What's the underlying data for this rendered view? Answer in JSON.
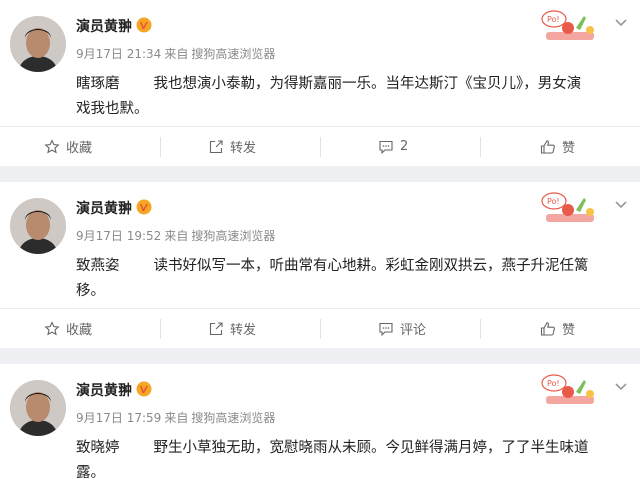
{
  "posts": [
    {
      "author": "演员黄翀",
      "time": "9月17日 21:34",
      "source_prefix": "来自",
      "source": "搜狗高速浏览器",
      "to": "瞎琢磨",
      "text_line1": "我也想演小泰勒，为得斯嘉丽一乐。当年达斯汀《宝贝儿》，男女演",
      "text_line2": "戏我也默。",
      "actions": {
        "favorite": "收藏",
        "repost": "转发",
        "comment": "2",
        "like": "赞"
      }
    },
    {
      "author": "演员黄翀",
      "time": "9月17日 19:52",
      "source_prefix": "来自",
      "source": "搜狗高速浏览器",
      "to": "致燕姿",
      "text_line1": "读书好似写一本，听曲常有心地耕。彩虹金刚双拱云，燕子升泥任篱",
      "text_line2": "移。",
      "actions": {
        "favorite": "收藏",
        "repost": "转发",
        "comment": "评论",
        "like": "赞"
      }
    },
    {
      "author": "演员黄翀",
      "time": "9月17日 17:59",
      "source_prefix": "来自",
      "source": "搜狗高速浏览器",
      "to": "致晓婷",
      "text_line1": "野生小草独无助，宽慰晓雨从未顾。今见鲜得满月婷，了了半生味道",
      "text_line2": "露。"
    }
  ],
  "icons": [
    "vip-badge-icon",
    "star-icon",
    "repost-icon",
    "comment-icon",
    "thumbs-up-icon",
    "chevron-down-icon"
  ],
  "colors": {
    "accent_vip": "#f5a623",
    "vip_red": "#e8533e",
    "meta_gray": "#8a8a8a",
    "page_bg": "#eef0f4"
  }
}
